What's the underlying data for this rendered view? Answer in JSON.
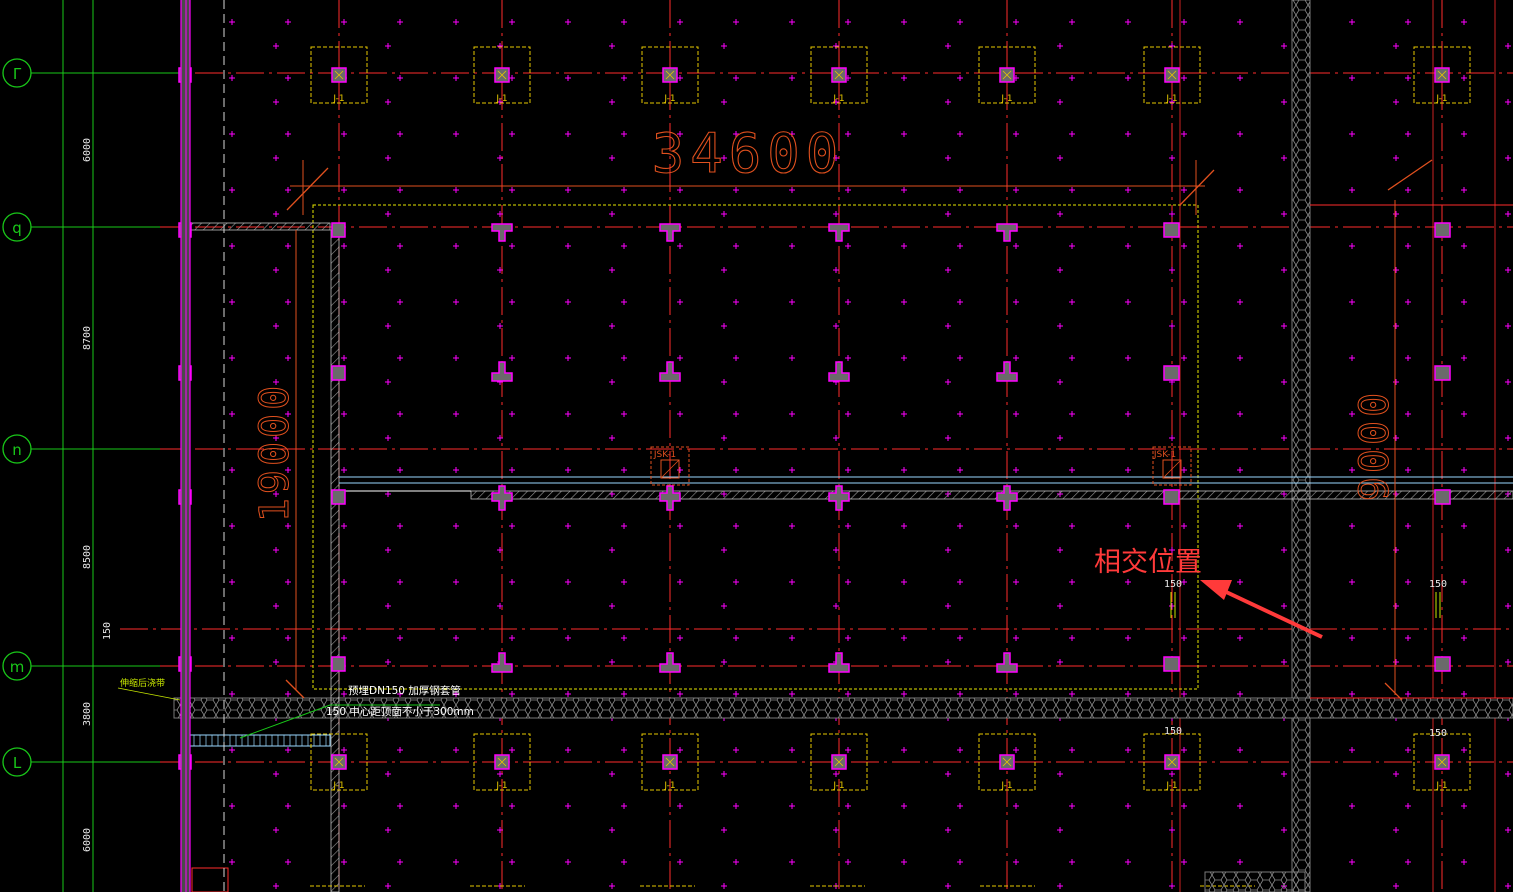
{
  "colors": {
    "background": "#000000",
    "grid_axis": "#ff2b2b",
    "axis_bubble": "#19c819",
    "point_marker": "#ff00ff",
    "column": "#ff00ff",
    "column_fill": "#6a6a6a",
    "footing_outline": "#e6c800",
    "pit_outline": "#e6e600",
    "dimension": "#e0501e",
    "annotation": "#ff3a3a",
    "wall": "#c0c0c0",
    "band": "#7a7a7a",
    "note_text": "#ffffff",
    "note_green": "#c8e800"
  },
  "axis_bubbles": [
    "Γ",
    "q",
    "n",
    "m",
    "L"
  ],
  "left_dimensions": [
    "6000",
    "8700",
    "8500",
    "3800",
    "6000"
  ],
  "footing_label": "J-1",
  "pit_labels": [
    "JSK-1",
    "JSK-1"
  ],
  "main_dimension": "34600",
  "vertical_dimensions": [
    "19000",
    "9000"
  ],
  "small_dimension": "150",
  "annotation": "相交位置",
  "notes": {
    "pipe": "预埋DN150 加厚钢套管",
    "pipe_depth": "150 中心距顶面不小于300mm",
    "left_label": "伸缩后浇带"
  }
}
